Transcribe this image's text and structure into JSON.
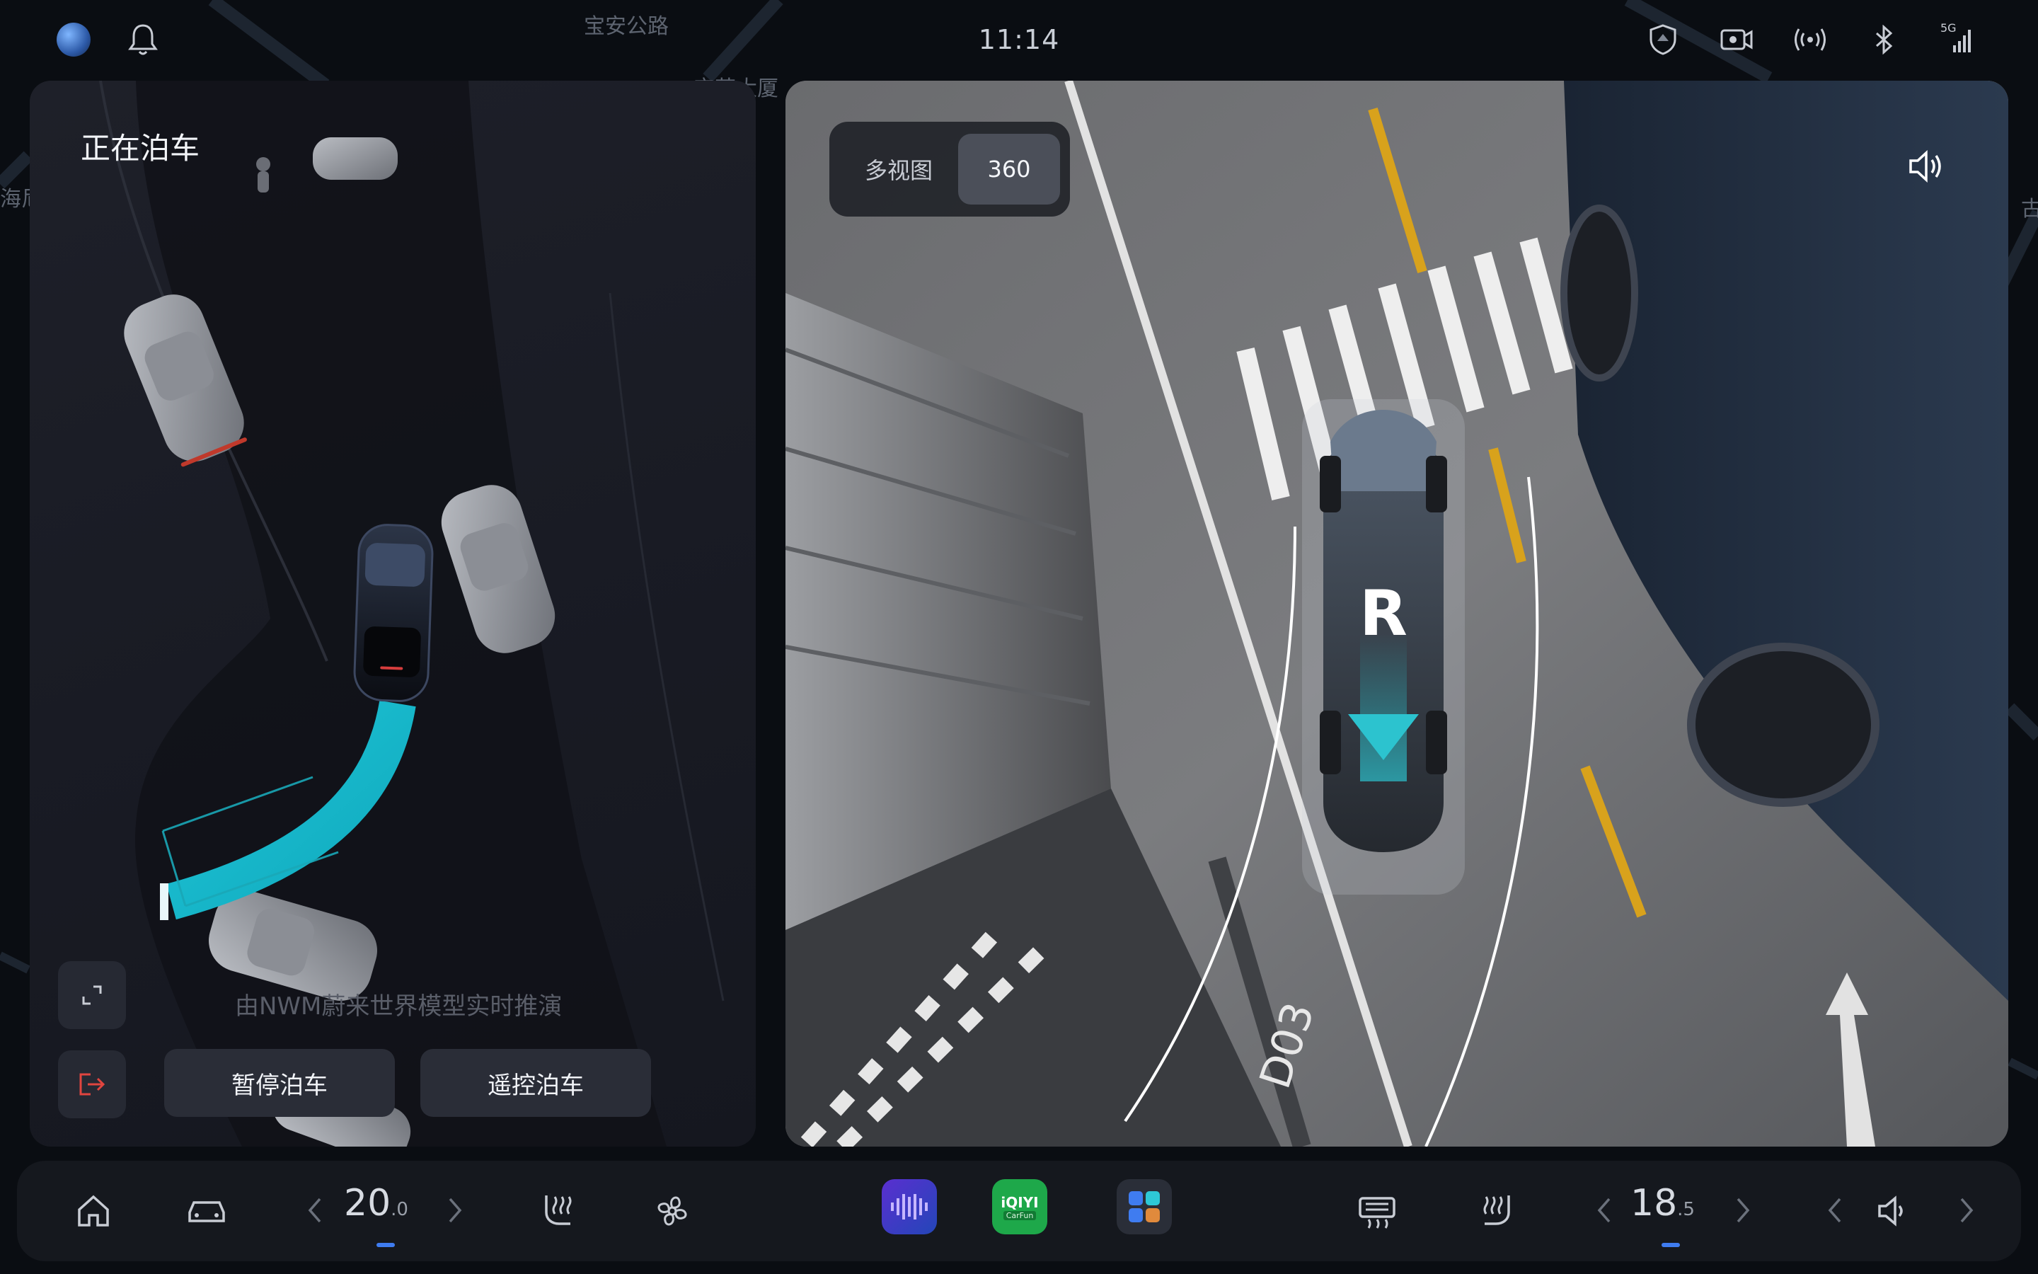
{
  "status_bar": {
    "time": "11:14",
    "icons": [
      "globe-icon",
      "bell-icon",
      "shield-car-icon",
      "dashcam-icon",
      "hotspot-icon",
      "bluetooth-icon",
      "cellular-5g-icon"
    ],
    "network_label": "5G"
  },
  "map": {
    "road_label": "宝安公路",
    "building_label": "宝苑大厦",
    "left_edge_label": "海尼",
    "right_edge_label": "古"
  },
  "parking_panel": {
    "title": "正在泊车",
    "caption": "由NWM蔚来世界模型实时推演",
    "pause_button": "暂停泊车",
    "remote_button": "遥控泊车"
  },
  "camera_panel": {
    "view_options": [
      "多视图",
      "360"
    ],
    "selected_view": "360",
    "gear": "R",
    "slot_marking": "D03"
  },
  "dock": {
    "left_temp": {
      "whole": "20",
      "decimal": ".0"
    },
    "right_temp": {
      "whole": "18",
      "decimal": ".5"
    },
    "iqiyi_label": "iQIYI",
    "iqiyi_sub": "CarFun"
  },
  "colors": {
    "accent_cyan": "#2ec8d6",
    "exit_red": "#e0453f",
    "dock_indicator": "#3f7cf0"
  }
}
